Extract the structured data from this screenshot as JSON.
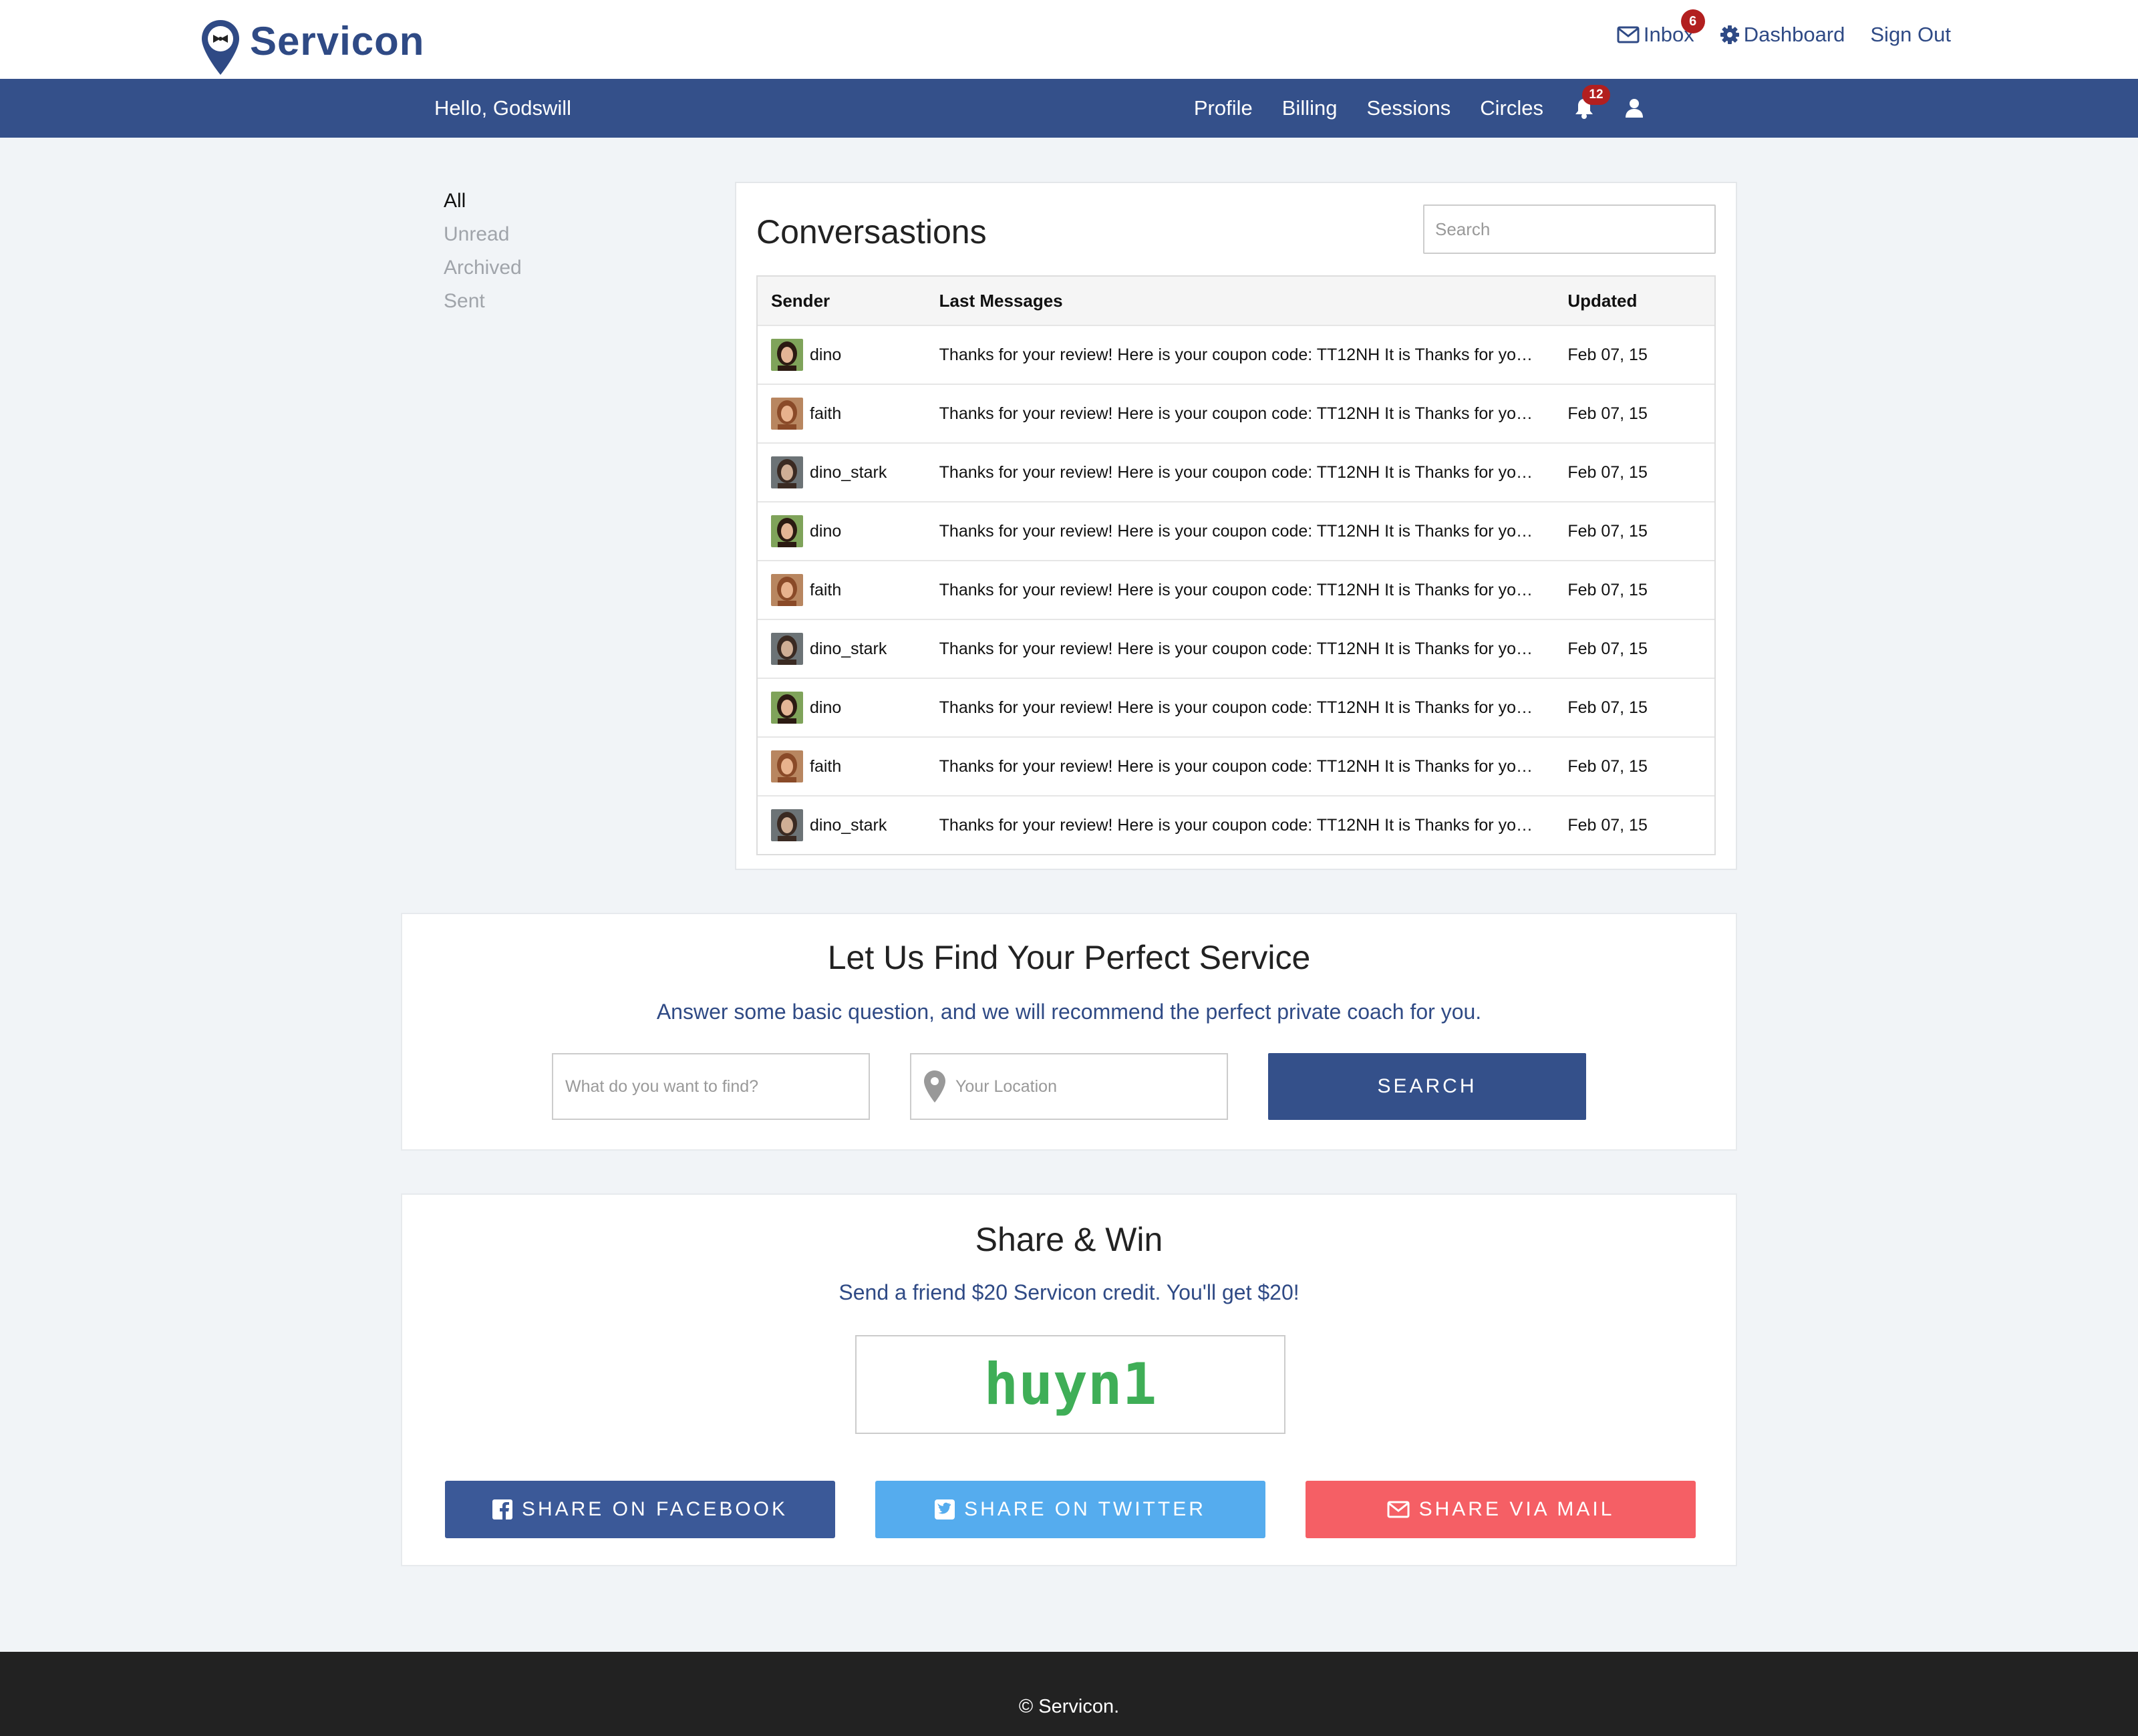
{
  "header": {
    "logo_text": "Servicon",
    "inbox_label": "Inbox",
    "inbox_badge": "6",
    "dashboard_label": "Dashboard",
    "signout_label": "Sign Out"
  },
  "navbar": {
    "greeting": "Hello, Godswill",
    "links": [
      "Profile",
      "Billing",
      "Sessions",
      "Circles"
    ],
    "notifications_badge": "12"
  },
  "filters": [
    "All",
    "Unread",
    "Archived",
    "Sent"
  ],
  "conversations": {
    "title": "Conversastions",
    "search_placeholder": "Search",
    "columns": [
      "Sender",
      "Last Messages",
      "Updated"
    ],
    "rows": [
      {
        "sender": "dino",
        "message": "Thanks for your review! Here is your coupon code: TT12NH It is Thanks for your review! Here is your coupon code",
        "updated": "Feb 07, 15"
      },
      {
        "sender": "faith",
        "message": "Thanks for your review! Here is your coupon code: TT12NH It is Thanks for your review! Here is your coupon code",
        "updated": "Feb 07, 15"
      },
      {
        "sender": "dino_stark",
        "message": "Thanks for your review! Here is your coupon code: TT12NH It is Thanks for your review! Here is your coupon code",
        "updated": "Feb 07, 15"
      },
      {
        "sender": "dino",
        "message": "Thanks for your review! Here is your coupon code: TT12NH It is Thanks for your review! Here is your coupon code",
        "updated": "Feb 07, 15"
      },
      {
        "sender": "faith",
        "message": "Thanks for your review! Here is your coupon code: TT12NH It is Thanks for your review! Here is your coupon code",
        "updated": "Feb 07, 15"
      },
      {
        "sender": "dino_stark",
        "message": "Thanks for your review! Here is your coupon code: TT12NH It is Thanks for your review! Here is your coupon code",
        "updated": "Feb 07, 15"
      },
      {
        "sender": "dino",
        "message": "Thanks for your review! Here is your coupon code: TT12NH It is Thanks for your review! Here is your coupon code",
        "updated": "Feb 07, 15"
      },
      {
        "sender": "faith",
        "message": "Thanks for your review! Here is your coupon code: TT12NH It is Thanks for your review! Here is your coupon code",
        "updated": "Feb 07, 15"
      },
      {
        "sender": "dino_stark",
        "message": "Thanks for your review! Here is your coupon code: TT12NH It is Thanks for your review! Here is your coupon code",
        "updated": "Feb 07, 15"
      }
    ]
  },
  "find": {
    "title": "Let Us Find Your Perfect Service",
    "subtitle": "Answer some basic question, and we will recommend the perfect private coach for you.",
    "what_placeholder": "What do you want to find?",
    "location_placeholder": "Your Location",
    "search_button": "SEARCH"
  },
  "share": {
    "title": "Share & Win",
    "subtitle": "Send a friend $20 Servicon credit. You'll get $20!",
    "code": "huyn1",
    "facebook_button": "SHARE ON FACEBOOK",
    "twitter_button": "SHARE ON TWITTER",
    "mail_button": "SHARE VIA MAIL"
  },
  "footer": {
    "text": "© Servicon."
  },
  "colors": {
    "brand": "#34508a",
    "badge": "#b21f1f",
    "code": "#3fae57",
    "facebook": "#3b5998",
    "twitter": "#55acee",
    "mail": "#f55f65"
  }
}
